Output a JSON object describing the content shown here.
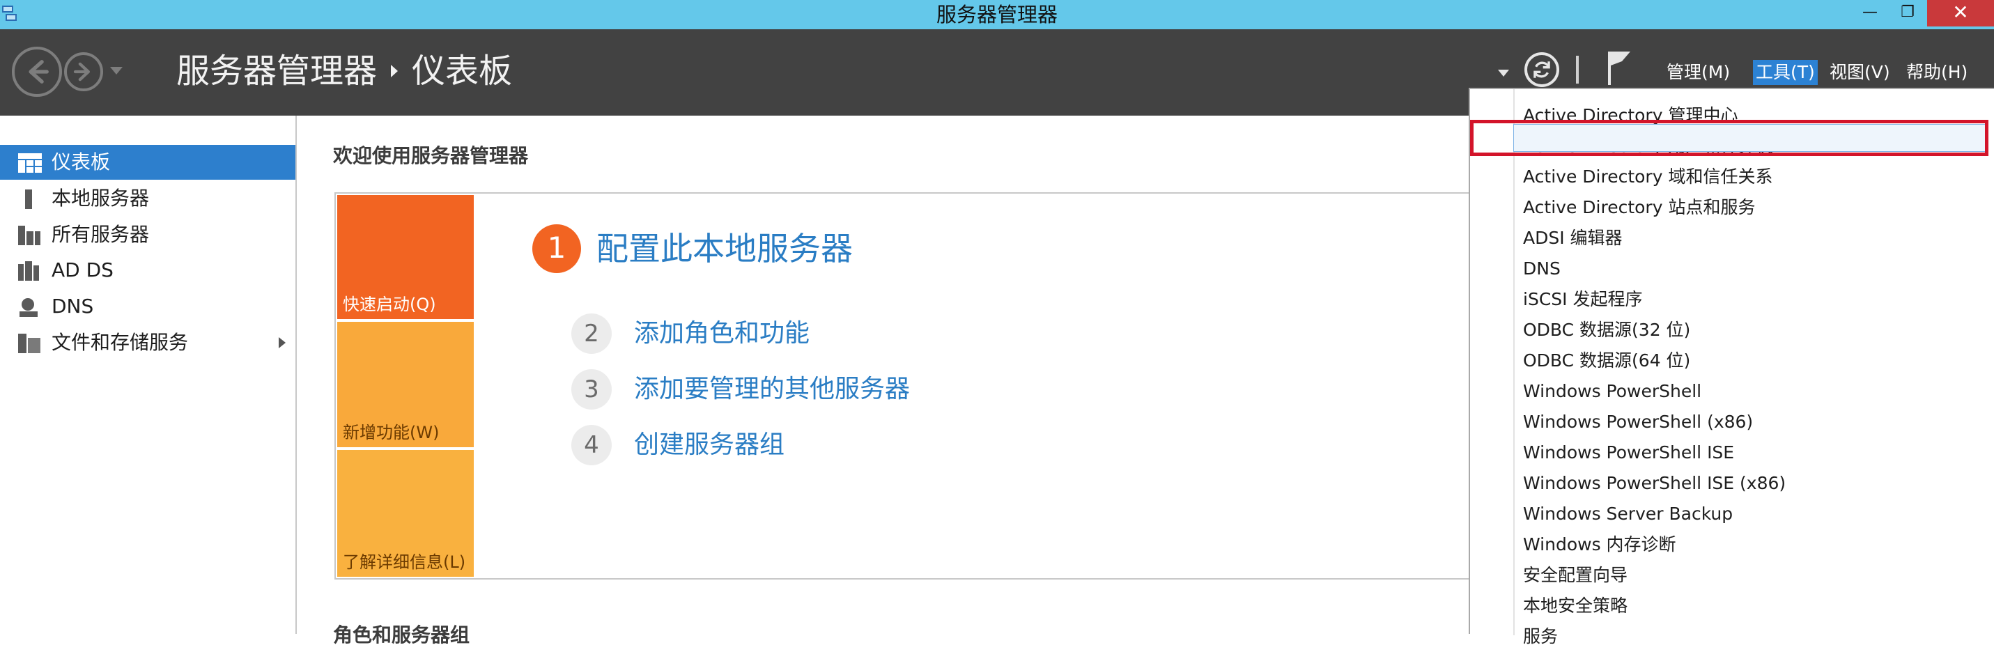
{
  "window": {
    "title": "服务器管理器",
    "min_icon": "minimize-icon",
    "max_icon": "restore-icon",
    "close_icon": "close-icon"
  },
  "header": {
    "breadcrumb_root": "服务器管理器",
    "breadcrumb_current": "仪表板",
    "menus": {
      "manage": "管理(M)",
      "tools": "工具(T)",
      "view": "视图(V)",
      "help": "帮助(H)"
    }
  },
  "sidebar": {
    "items": [
      {
        "label": "仪表板",
        "icon": "dashboard-icon",
        "active": true
      },
      {
        "label": "本地服务器",
        "icon": "server-icon"
      },
      {
        "label": "所有服务器",
        "icon": "servers-icon"
      },
      {
        "label": "AD DS",
        "icon": "directory-icon"
      },
      {
        "label": "DNS",
        "icon": "dns-icon"
      },
      {
        "label": "文件和存储服务",
        "icon": "storage-icon"
      }
    ]
  },
  "main": {
    "welcome": "欢迎使用服务器管理器",
    "tiles": {
      "quick_start": "快速启动(Q)",
      "whats_new": "新增功能(W)",
      "learn_more": "了解详细信息(L)"
    },
    "step1": {
      "num": "1",
      "text": "配置此本地服务器"
    },
    "steps": [
      {
        "num": "2",
        "text": "添加角色和功能"
      },
      {
        "num": "3",
        "text": "添加要管理的其他服务器"
      },
      {
        "num": "4",
        "text": "创建服务器组"
      }
    ],
    "section2": "角色和服务器组"
  },
  "tools_menu": {
    "items": [
      "Active Directory 管理中心",
      "Active Directory 用户和计算机",
      "Active Directory 域和信任关系",
      "Active Directory 站点和服务",
      "ADSI 编辑器",
      "DNS",
      "iSCSI 发起程序",
      "ODBC 数据源(32 位)",
      "ODBC 数据源(64 位)",
      "Windows PowerShell",
      "Windows PowerShell (x86)",
      "Windows PowerShell ISE",
      "Windows PowerShell ISE (x86)",
      "Windows Server Backup",
      "Windows 内存诊断",
      "安全配置向导",
      "本地安全策略",
      "服务"
    ],
    "highlighted_index": 1
  },
  "colors": {
    "titlebar": "#64c8ea",
    "header": "#424242",
    "accent": "#2d7fcd",
    "quick_start": "#f26422",
    "tile_secondary": "#f9a93b",
    "highlight_box": "#d3142a"
  }
}
